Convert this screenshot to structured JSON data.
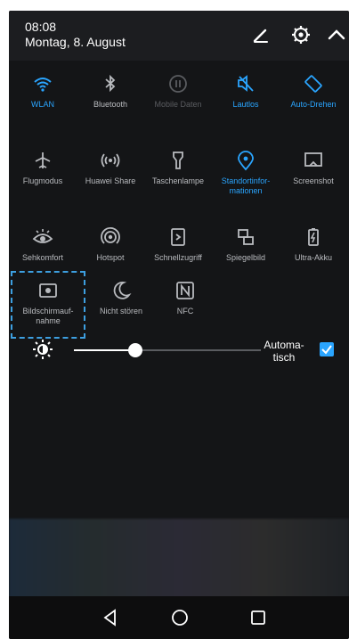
{
  "status": {
    "time": "08:08",
    "date": "Montag, 8. August",
    "icons": [
      "edit-icon",
      "settings-icon",
      "collapse-icon"
    ]
  },
  "tiles": [
    {
      "label": "WLAN",
      "icon": "wifi-icon",
      "state": "on"
    },
    {
      "label": "Bluetooth",
      "icon": "bluetooth-icon",
      "state": "off"
    },
    {
      "label": "Mobile Daten",
      "icon": "mobile-data-icon",
      "state": "disabled"
    },
    {
      "label": "Lautlos",
      "icon": "mute-icon",
      "state": "on"
    },
    {
      "label": "Auto-Drehen",
      "icon": "rotate-icon",
      "state": "on"
    },
    {
      "label": "Flugmodus",
      "icon": "airplane-icon",
      "state": "off"
    },
    {
      "label": "Huawei Share",
      "icon": "share-icon",
      "state": "off"
    },
    {
      "label": "Taschenlampe",
      "icon": "flashlight-icon",
      "state": "off"
    },
    {
      "label": "Standortinfor-\nmationen",
      "icon": "location-icon",
      "state": "on"
    },
    {
      "label": "Screenshot",
      "icon": "screenshot-icon",
      "state": "off"
    },
    {
      "label": "Sehkomfort",
      "icon": "eye-comfort-icon",
      "state": "off"
    },
    {
      "label": "Hotspot",
      "icon": "hotspot-icon",
      "state": "off"
    },
    {
      "label": "Schnellzugriff",
      "icon": "quick-access-icon",
      "state": "off"
    },
    {
      "label": "Spiegelbild",
      "icon": "mirror-icon",
      "state": "off"
    },
    {
      "label": "Ultra-Akku",
      "icon": "battery-icon",
      "state": "off"
    },
    {
      "label": "Bildschirmauf-\nnahme",
      "icon": "screen-record-icon",
      "state": "off"
    },
    {
      "label": "Nicht stören",
      "icon": "moon-icon",
      "state": "off"
    },
    {
      "label": "NFC",
      "icon": "nfc-icon",
      "state": "off"
    }
  ],
  "brightness": {
    "level": 0.33,
    "auto_label": "Automa-\ntisch",
    "auto_checked": true
  },
  "colors": {
    "accent": "#2aa5ff",
    "background": "#141517",
    "highlight_dash": "#3d9fe0"
  }
}
